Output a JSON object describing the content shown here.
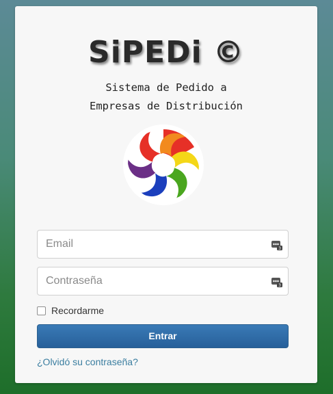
{
  "brand": {
    "title": "SiPEDi ©",
    "subtitle_line1": "Sistema de Pedido a",
    "subtitle_line2": "Empresas de Distribución"
  },
  "login": {
    "email_placeholder": "Email",
    "password_placeholder": "Contraseña",
    "remember_label": "Recordarme",
    "remember_checked": false,
    "submit_label": "Entrar",
    "forgot_link": "¿Olvidó su contraseña?"
  },
  "colors": {
    "submit_top": "#3a7ab6",
    "submit_bottom": "#27609a",
    "link": "#3b7ea0",
    "card_bg": "#f7f7f7",
    "emblem_segments": [
      "#e63027",
      "#f28a1e",
      "#f4d718",
      "#4aa61f",
      "#1b3fbd",
      "#6b2f86"
    ]
  },
  "icons": {
    "email_field": "password-manager-icon",
    "password_field": "password-manager-icon",
    "emblem": "rainbow-swirl-logo"
  }
}
